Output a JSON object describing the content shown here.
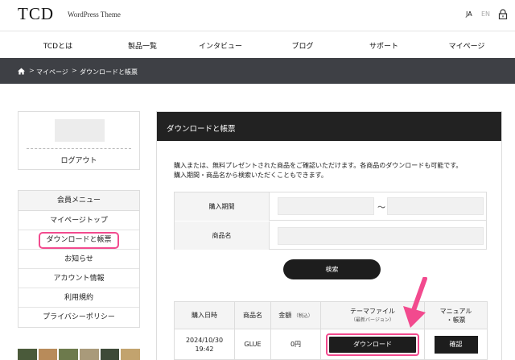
{
  "header": {
    "logo": "TCD",
    "tagline": "WordPress Theme",
    "lang_ja": "JA",
    "lang_en": "EN",
    "lock_icon": "lock-icon"
  },
  "nav": {
    "items": [
      "TCDとは",
      "製品一覧",
      "インタビュー",
      "ブログ",
      "サポート",
      "マイページ"
    ]
  },
  "breadcrumb": {
    "home_icon": "home-icon",
    "separator": ">",
    "items": [
      "マイページ",
      "ダウンロードと帳票"
    ]
  },
  "profile": {
    "logout": "ログアウト"
  },
  "menu": {
    "header": "会員メニュー",
    "items": [
      "マイページトップ",
      "ダウンロードと帳票",
      "お知らせ",
      "アカウント情報",
      "利用規約",
      "プライバシーポリシー"
    ],
    "active": "ダウンロードと帳票"
  },
  "main": {
    "title": "ダウンロードと帳票",
    "description": [
      "購入または、無料プレゼントされた商品をご確認いただけます。各商品のダウンロードも可能です。",
      "購入期間・商品名から検索いただくこともできます。"
    ],
    "form": {
      "period_label": "購入期間",
      "range_separator": "～",
      "product_label": "商品名",
      "search_button": "検索"
    },
    "table": {
      "headers": {
        "date": "購入日時",
        "product": "商品名",
        "amount": "金額",
        "amount_note": "（税込）",
        "theme_file": "テーマファイル",
        "theme_file_note": "（最新バージョン）",
        "manual": "マニュアル",
        "manual_2": "・帳票"
      },
      "rows": [
        {
          "date": "2024/10/30",
          "time": "19:42",
          "product": "GLUE",
          "amount": "0円",
          "download": "ダウンロード",
          "confirm": "確認"
        }
      ]
    }
  },
  "colors": {
    "dark": "#222222",
    "breadcrumb_bg": "#3e4045",
    "highlight": "#f24a8e",
    "light_bg": "#f4f4f4"
  }
}
